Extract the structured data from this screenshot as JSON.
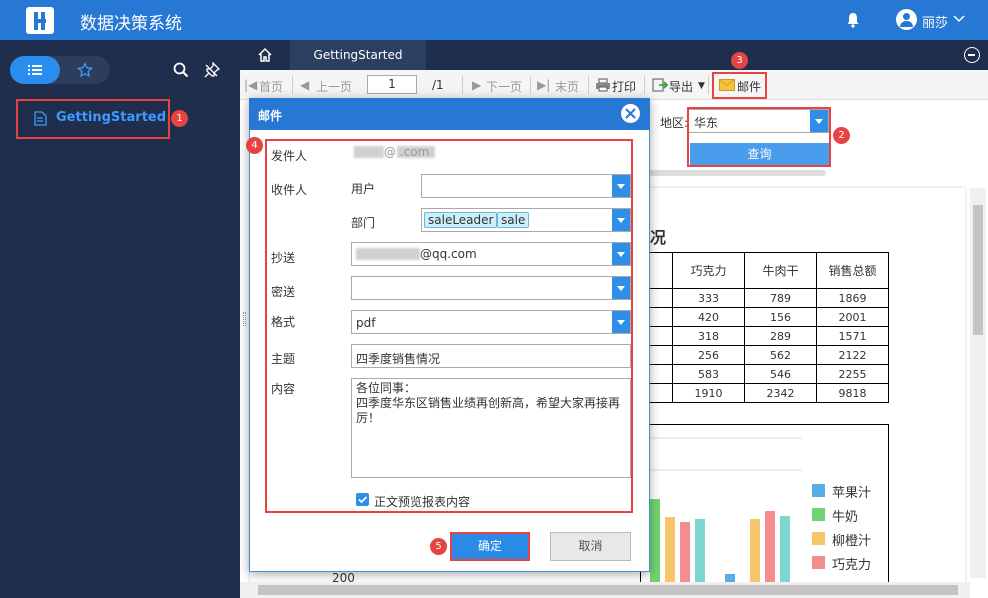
{
  "app": {
    "title": "数据决策系统",
    "user": "丽莎"
  },
  "sidebar": {
    "items": [
      {
        "label": "GettingStarted"
      }
    ]
  },
  "tabs": [
    {
      "label": "GettingStarted"
    }
  ],
  "toolbar": {
    "first": "首页",
    "prev": "上一页",
    "page": "1",
    "total": "/1",
    "next": "下一页",
    "last": "末页",
    "print": "打印",
    "export": "导出",
    "mail": "邮件"
  },
  "filter": {
    "region_label": "地区:",
    "region_value": "华东",
    "query": "查询"
  },
  "report": {
    "title_fragment": "况",
    "columns": [
      "巧克力",
      "牛肉干",
      "销售总额"
    ],
    "rows": [
      [
        "333",
        "789",
        "1869"
      ],
      [
        "420",
        "156",
        "2001"
      ],
      [
        "318",
        "289",
        "1571"
      ],
      [
        "256",
        "562",
        "2122"
      ],
      [
        "583",
        "546",
        "2255"
      ],
      [
        "1910",
        "2342",
        "9818"
      ]
    ],
    "axis_tick": "200",
    "legend": [
      {
        "label": "苹果汁",
        "color": "#5aaee8"
      },
      {
        "label": "牛奶",
        "color": "#6fd46f"
      },
      {
        "label": "柳橙汁",
        "color": "#f6c56c"
      },
      {
        "label": "巧克力",
        "color": "#f48e8e"
      }
    ]
  },
  "dialog": {
    "title": "邮件",
    "sender_label": "发件人",
    "sender_value": "@          .com",
    "recipient_label": "收件人",
    "user_label": "用户",
    "dept_label": "部门",
    "dept_chips": [
      "saleLeader",
      "sale"
    ],
    "cc_label": "抄送",
    "cc_value": "@qq.com",
    "bcc_label": "密送",
    "format_label": "格式",
    "format_value": "pdf",
    "subject_label": "主题",
    "subject_value": "四季度销售情况",
    "body_label": "内容",
    "body_value": "各位同事：\n四季度华东区销售业绩再创新高，希望大家再接再厉！",
    "preview_label": "正文预览报表内容",
    "ok": "确定",
    "cancel": "取消"
  },
  "annotations": [
    "1",
    "2",
    "3",
    "4",
    "5"
  ]
}
